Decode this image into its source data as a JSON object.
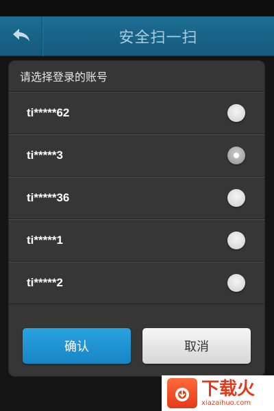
{
  "header": {
    "title": "安全扫一扫",
    "back_icon": "back-arrow-icon"
  },
  "dialog": {
    "title": "请选择登录的账号",
    "accounts": [
      {
        "label": "ti*****62",
        "selected": false
      },
      {
        "label": "ti*****3",
        "selected": true
      },
      {
        "label": "ti*****36",
        "selected": false
      },
      {
        "label": "ti*****1",
        "selected": false
      },
      {
        "label": "ti*****2",
        "selected": false
      }
    ],
    "confirm_label": "确认",
    "cancel_label": "取消"
  },
  "watermark": {
    "title": "下载火",
    "site": "xiazaihuo.com"
  },
  "colors": {
    "title_bar": "#1a6890",
    "confirm_button": "#1f92d2",
    "dialog_bg": "#363636"
  }
}
